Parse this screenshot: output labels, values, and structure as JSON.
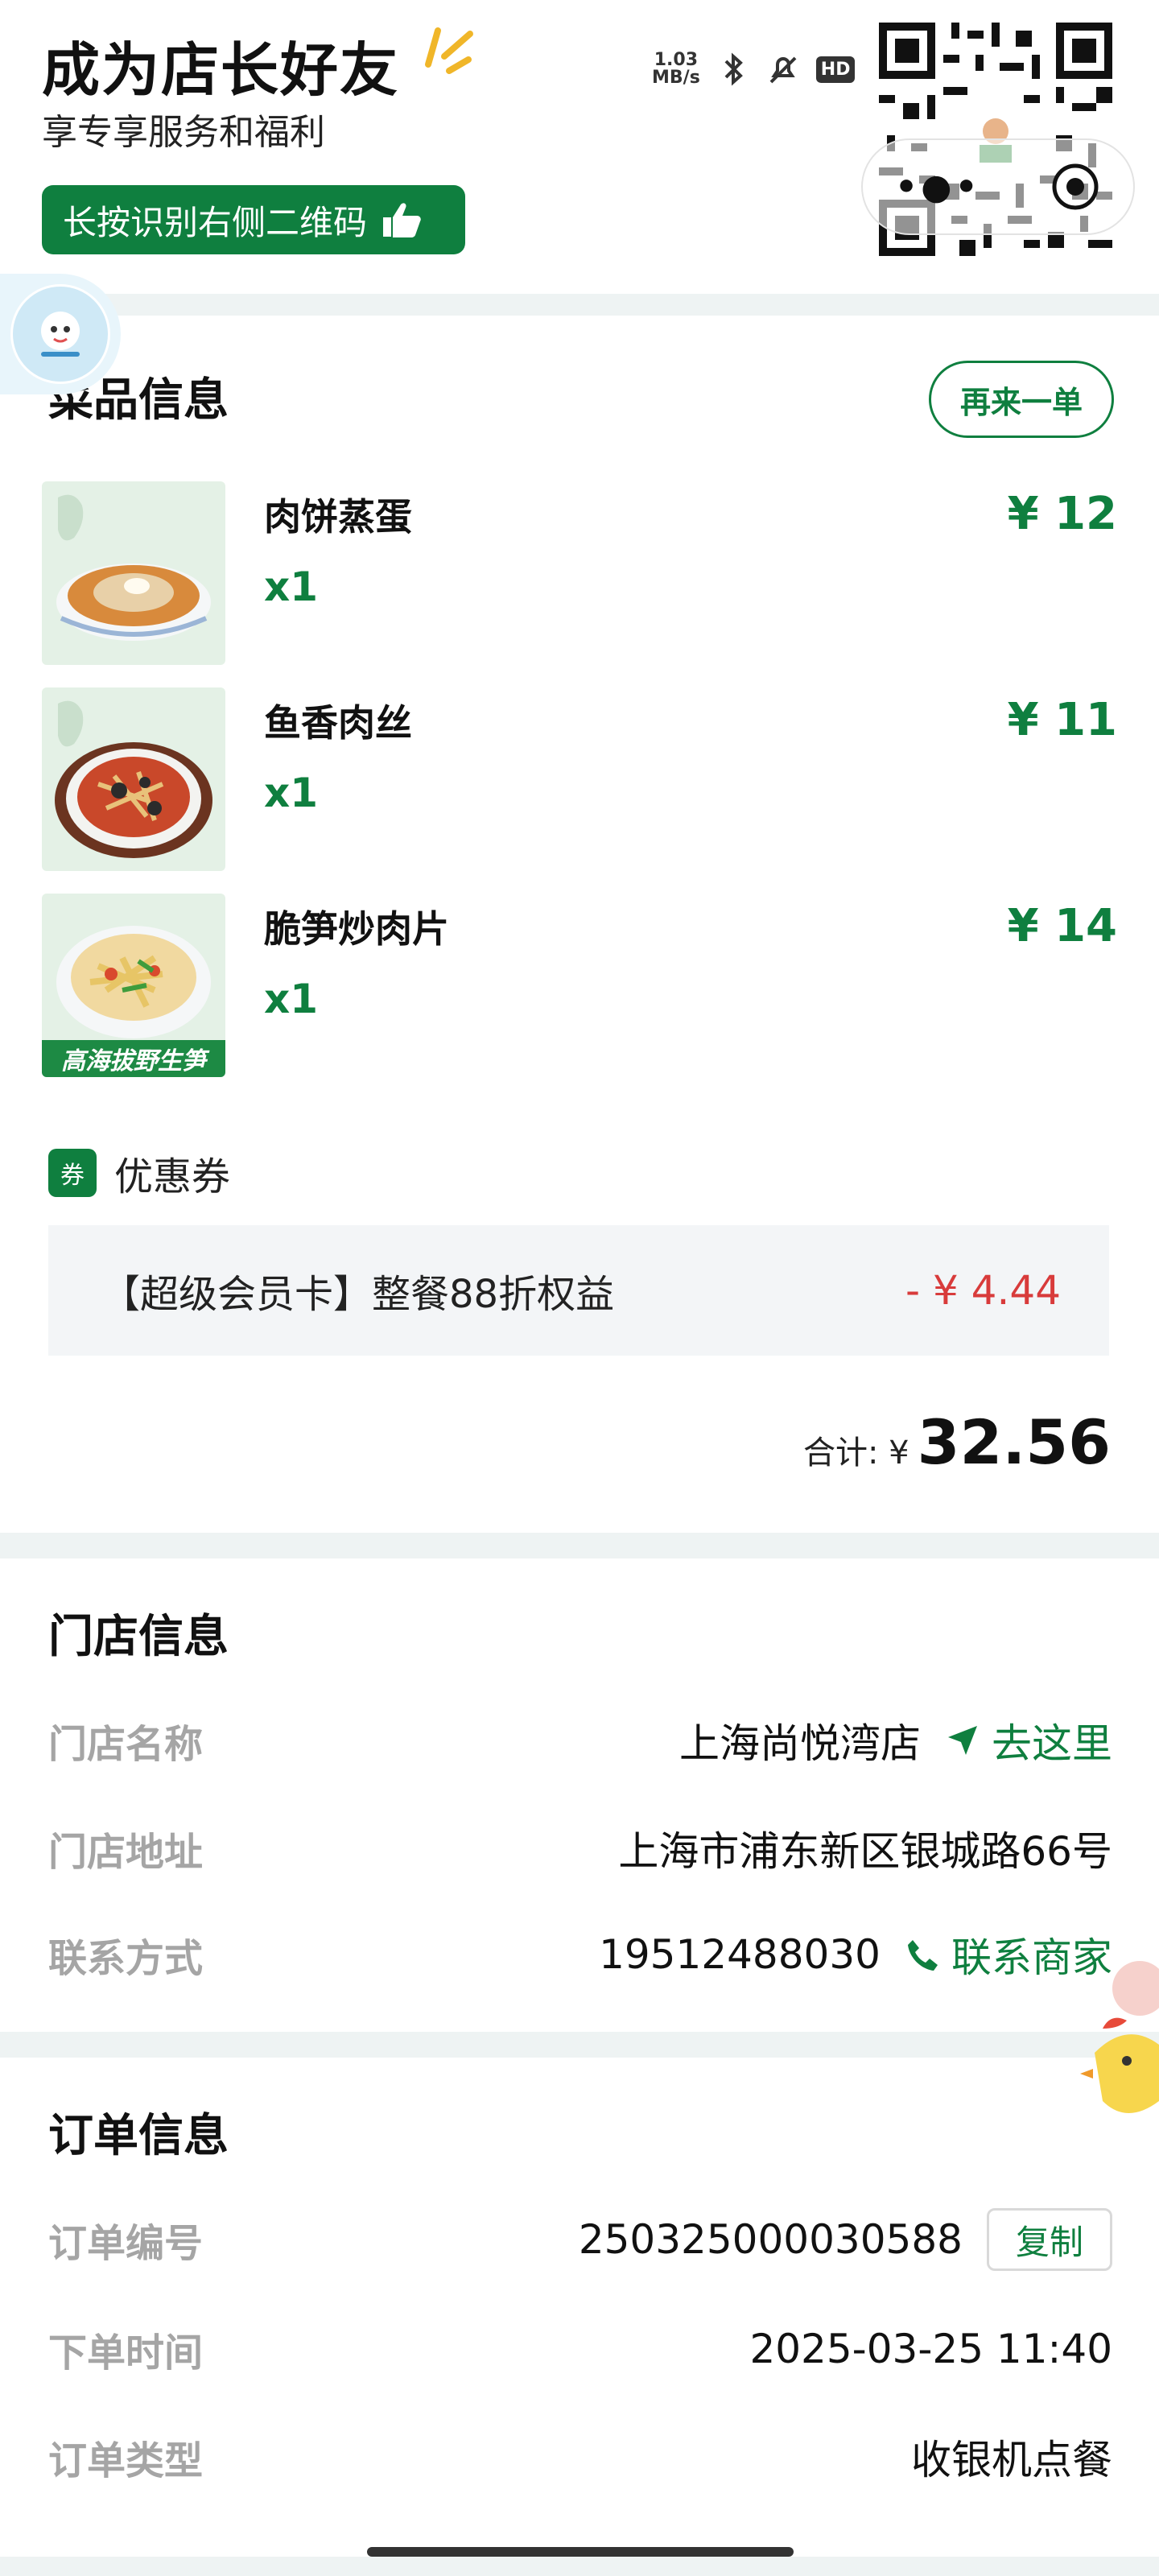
{
  "banner": {
    "title": "成为店长好友",
    "subtitle": "享专享服务和福利",
    "button_label": "长按识别右侧二维码"
  },
  "status_bar": {
    "net_speed_value": "1.03",
    "net_speed_unit": "MB/s",
    "hd_badge": "HD"
  },
  "food_section": {
    "title": "菜品信息",
    "reorder_label": "再来一单",
    "items": [
      {
        "name": "肉饼蒸蛋",
        "qty": "x1",
        "price": "¥ 12"
      },
      {
        "name": "鱼香肉丝",
        "qty": "x1",
        "price": "¥ 11"
      },
      {
        "name": "脆笋炒肉片",
        "qty": "x1",
        "price": "¥ 14",
        "image_caption": "高海拔野生笋"
      }
    ],
    "coupon": {
      "badge": "券",
      "label": "优惠券",
      "name": "【超级会员卡】整餐88折权益",
      "amount": "- ¥ 4.44"
    },
    "total": {
      "label": "合计: ¥",
      "value": "32.56"
    }
  },
  "store_section": {
    "title": "门店信息",
    "name_label": "门店名称",
    "name_value": "上海尚悦湾店",
    "nav_label": "去这里",
    "address_label": "门店地址",
    "address_value": "上海市浦东新区银城路66号",
    "contact_label": "联系方式",
    "contact_value": "19512488030",
    "contact_action": "联系商家"
  },
  "order_section": {
    "title": "订单信息",
    "number_label": "订单编号",
    "number_value": "250325000030588",
    "copy_label": "复制",
    "time_label": "下单时间",
    "time_value": "2025-03-25 11:40",
    "type_label": "订单类型",
    "type_value": "收银机点餐"
  },
  "colors": {
    "brand_green": "#0f7f3f",
    "discount_red": "#d83b3b",
    "label_gray": "#a5a5a5",
    "background": "#eef3f3"
  },
  "icons": [
    "hand-pointing-icon",
    "bluetooth-icon",
    "mute-icon",
    "more-dots-icon",
    "target-icon",
    "navigation-arrow-icon",
    "phone-icon",
    "qr-code"
  ]
}
